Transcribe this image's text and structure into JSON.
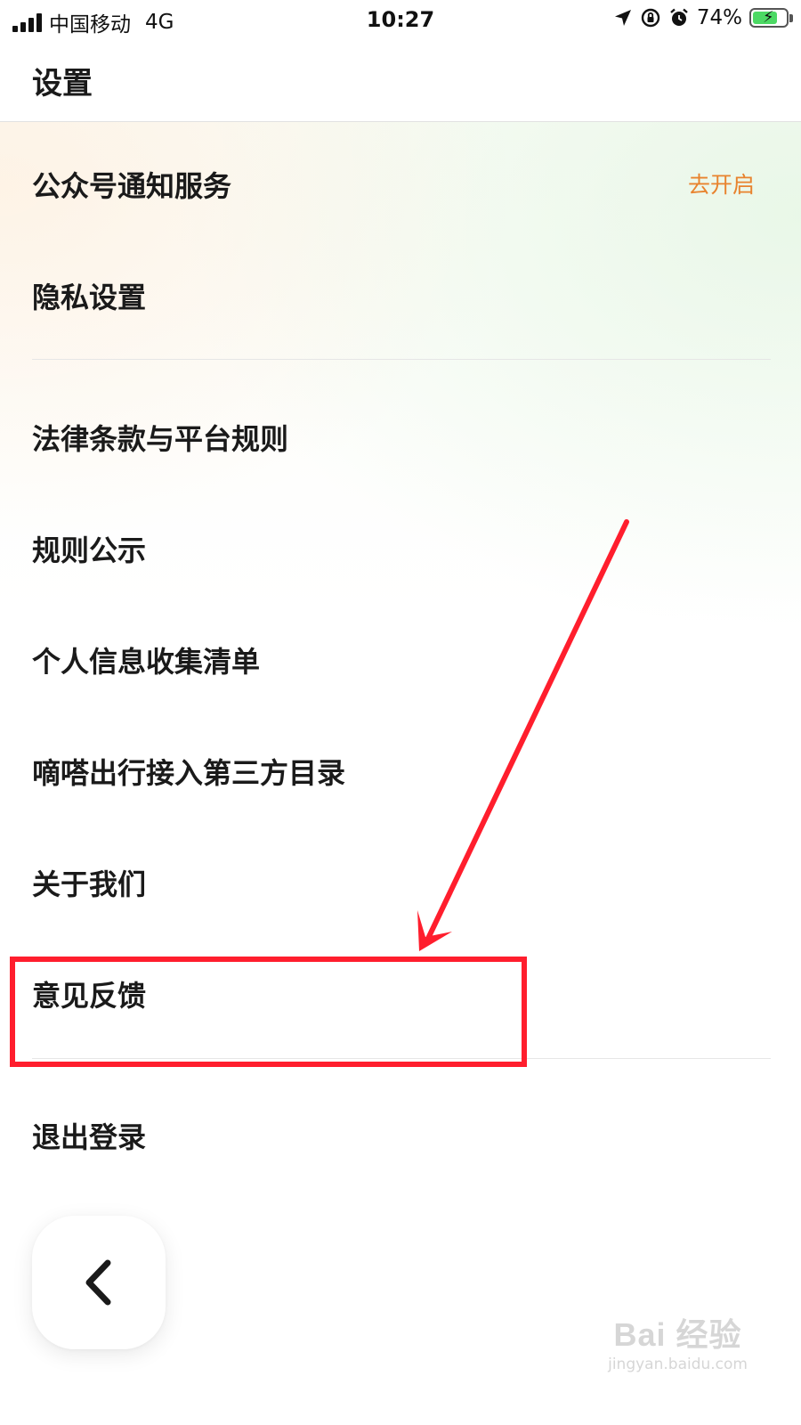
{
  "status_bar": {
    "carrier": "中国移动",
    "network": "4G",
    "time": "10:27",
    "battery": "74%",
    "battery_level": 0.74,
    "battery_color": "#4cd964"
  },
  "header": {
    "title": "设置"
  },
  "menu": {
    "items": [
      {
        "label": "公众号通知服务",
        "action": "去开启"
      },
      {
        "label": "隐私设置"
      },
      {
        "label": "法律条款与平台规则"
      },
      {
        "label": "规则公示"
      },
      {
        "label": "个人信息收集清单"
      },
      {
        "label": "嘀嗒出行接入第三方目录"
      },
      {
        "label": "关于我们"
      },
      {
        "label": "意见反馈"
      },
      {
        "label": "退出登录"
      }
    ]
  },
  "annotation": {
    "color": "#ff1e2d",
    "target": "意见反馈"
  },
  "watermark": {
    "main": "Bai 经验",
    "sub": "jingyan.baidu.com"
  },
  "accent_color": "#e8832e",
  "icons": {
    "back": "chevron-left-icon",
    "location": "location-arrow-icon",
    "rotation_lock": "rotation-lock-icon",
    "alarm": "alarm-clock-icon",
    "battery": "battery-charging-icon"
  }
}
